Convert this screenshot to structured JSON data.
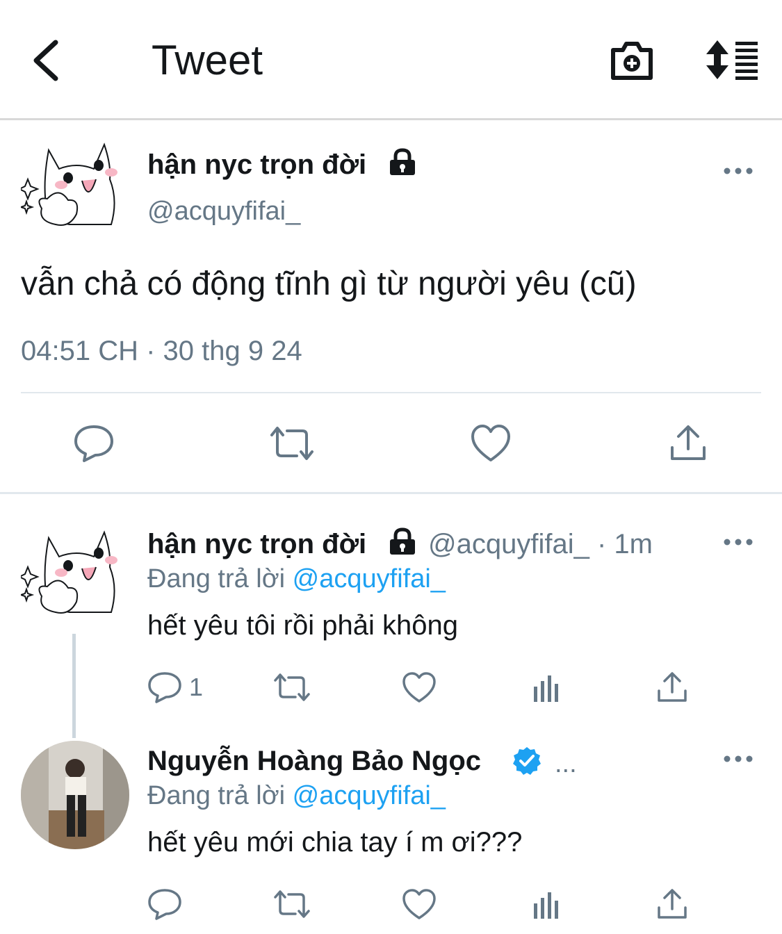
{
  "header": {
    "title": "Tweet",
    "back_icon": "chevron-left-icon",
    "camera_icon": "camera-plus-icon",
    "sort_icon": "sort-list-icon"
  },
  "main_tweet": {
    "display_name": "hận nyc trọn đời",
    "handle": "@acquyfifai_",
    "text": "vẫn chả có động tĩnh gì từ người yêu (cũ)",
    "timestamp": "04:51 CH · 30 thg 9 24",
    "locked": true
  },
  "replies": [
    {
      "display_name": "hận nyc trọn đời",
      "handle": "@acquyfifai_",
      "time": "· 1m",
      "replying_prefix": "Đang trả lời",
      "replying_to": "@acquyfifai_",
      "text": "hết yêu tôi rồi phải không",
      "reply_count": "1",
      "locked": true
    },
    {
      "display_name": "Nguyễn Hoàng Bảo Ngọc",
      "more": "...",
      "replying_prefix": "Đang trả lời",
      "replying_to": "@acquyfifai_",
      "text": "hết yêu mới chia tay í m ơi???",
      "verified": true
    }
  ],
  "colors": {
    "accent": "#1da1f2",
    "muted": "#657786",
    "divider": "#e1e8ed",
    "text": "#14171a"
  }
}
